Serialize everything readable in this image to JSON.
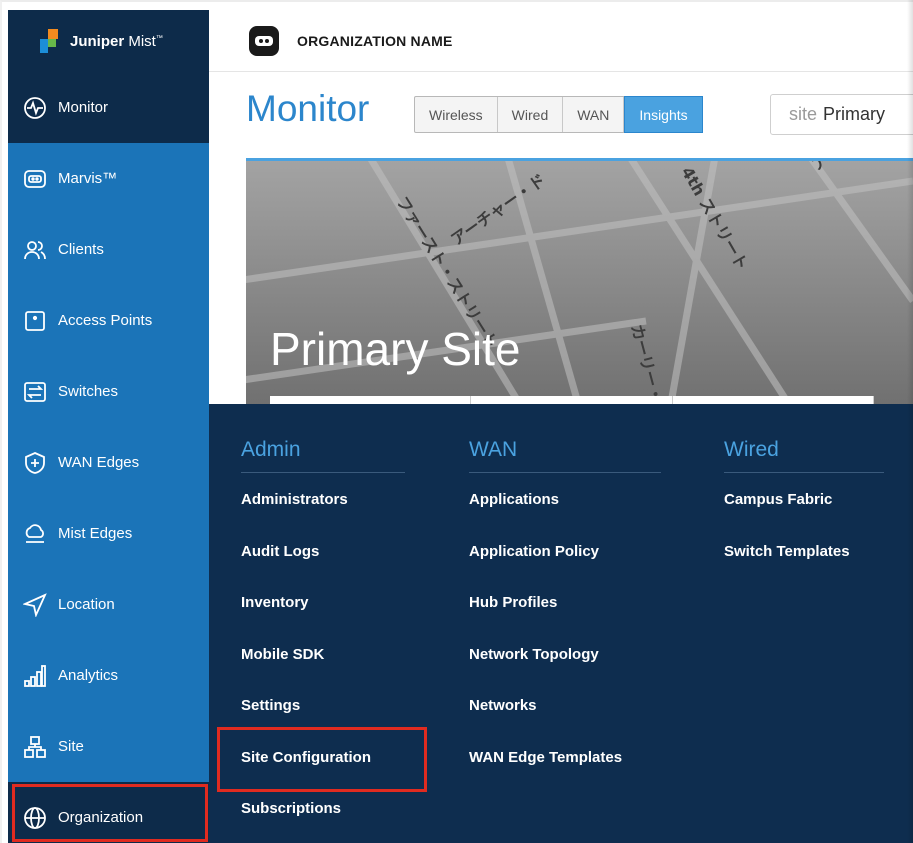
{
  "brand": {
    "name_bold": "Juniper",
    "name_light": "Mist",
    "tm": "™"
  },
  "header": {
    "org_name": "ORGANIZATION NAME"
  },
  "sidebar": {
    "items": [
      {
        "label": "Monitor",
        "icon": "monitor-icon"
      },
      {
        "label": "Marvis™",
        "icon": "marvis-icon"
      },
      {
        "label": "Clients",
        "icon": "clients-icon"
      },
      {
        "label": "Access Points",
        "icon": "access-point-icon"
      },
      {
        "label": "Switches",
        "icon": "switch-icon"
      },
      {
        "label": "WAN Edges",
        "icon": "wan-edge-icon"
      },
      {
        "label": "Mist Edges",
        "icon": "mist-edge-icon"
      },
      {
        "label": "Location",
        "icon": "location-icon"
      },
      {
        "label": "Analytics",
        "icon": "analytics-icon"
      },
      {
        "label": "Site",
        "icon": "site-icon"
      },
      {
        "label": "Organization",
        "icon": "globe-icon"
      }
    ]
  },
  "page": {
    "title": "Monitor",
    "tabs": [
      {
        "label": "Wireless"
      },
      {
        "label": "Wired"
      },
      {
        "label": "WAN"
      },
      {
        "label": "Insights"
      }
    ],
    "site_selector": {
      "label": "site",
      "value": "Primary"
    },
    "map_title": "Primary Site",
    "map_labels": [
      "ファースト・ストリート",
      "アーチャー・ド",
      "4th ストリート",
      "カーリー・",
      "アリーナ"
    ]
  },
  "org_menu": {
    "columns": [
      {
        "header": "Admin",
        "items": [
          "Administrators",
          "Audit Logs",
          "Inventory",
          "Mobile SDK",
          "Settings",
          "Site Configuration",
          "Subscriptions"
        ]
      },
      {
        "header": "WAN",
        "items": [
          "Applications",
          "Application Policy",
          "Hub Profiles",
          "Network Topology",
          "Networks",
          "WAN Edge Templates"
        ]
      },
      {
        "header": "Wired",
        "items": [
          "Campus Fabric",
          "Switch Templates"
        ]
      }
    ]
  },
  "colors": {
    "sidebar": "#1b74b8",
    "sidebar_dark": "#0d2b4a",
    "accent": "#4aa2e0",
    "highlight": "#e02b20"
  }
}
